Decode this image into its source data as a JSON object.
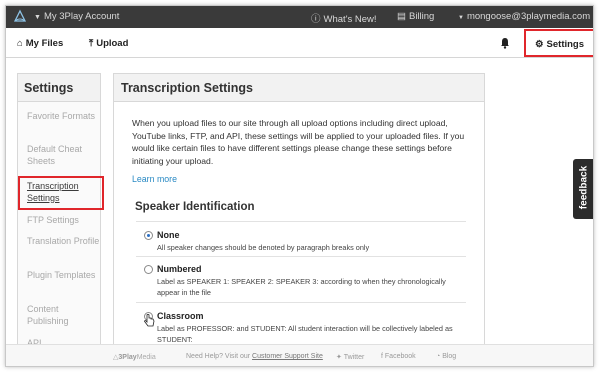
{
  "topbar": {
    "account": "My 3Play Account",
    "whats_new": "What's New!",
    "billing": "Billing",
    "email": "mongoose@3playmedia.com"
  },
  "nav": {
    "my_files": "My Files",
    "upload": "Upload",
    "settings": "Settings"
  },
  "sidebar": {
    "title": "Settings",
    "items": [
      {
        "label": "Favorite Formats"
      },
      {
        "label": "Default Cheat Sheets"
      },
      {
        "label": "Transcription Settings"
      },
      {
        "label": "FTP Settings"
      },
      {
        "label": "Translation Profile"
      },
      {
        "label": "Plugin Templates"
      },
      {
        "label": "Content Publishing"
      },
      {
        "label": "API"
      }
    ]
  },
  "main": {
    "title": "Transcription Settings",
    "description": "When you upload files to our site through all upload options including direct upload, YouTube links, FTP, and API, these settings will be applied to your uploaded files. If you would like certain files to have different settings please change these settings before initiating your upload.",
    "learn_more": "Learn more",
    "section_title": "Speaker Identification",
    "options": [
      {
        "title": "None",
        "note": "All speaker changes should be denoted by paragraph breaks only",
        "selected": true
      },
      {
        "title": "Numbered",
        "note": "Label as SPEAKER 1: SPEAKER 2: SPEAKER 3: according to when they chronologically appear in the file",
        "selected": false
      },
      {
        "title": "Classroom",
        "note": "Label as PROFESSOR: and STUDENT: All student interaction will be collectively labeled as STUDENT:",
        "selected": false
      }
    ]
  },
  "footer": {
    "brand_a": "3Play",
    "brand_b": "Media",
    "help_text": "Need Help? Visit our",
    "help_link": "Customer Support Site",
    "twitter": "Twitter",
    "facebook": "Facebook",
    "blog": "Blog"
  },
  "feedback": "feedback",
  "colors": {
    "topbar_bg": "#3a3a3a",
    "link": "#2a8ac4",
    "highlight_box": "#e0262b"
  }
}
